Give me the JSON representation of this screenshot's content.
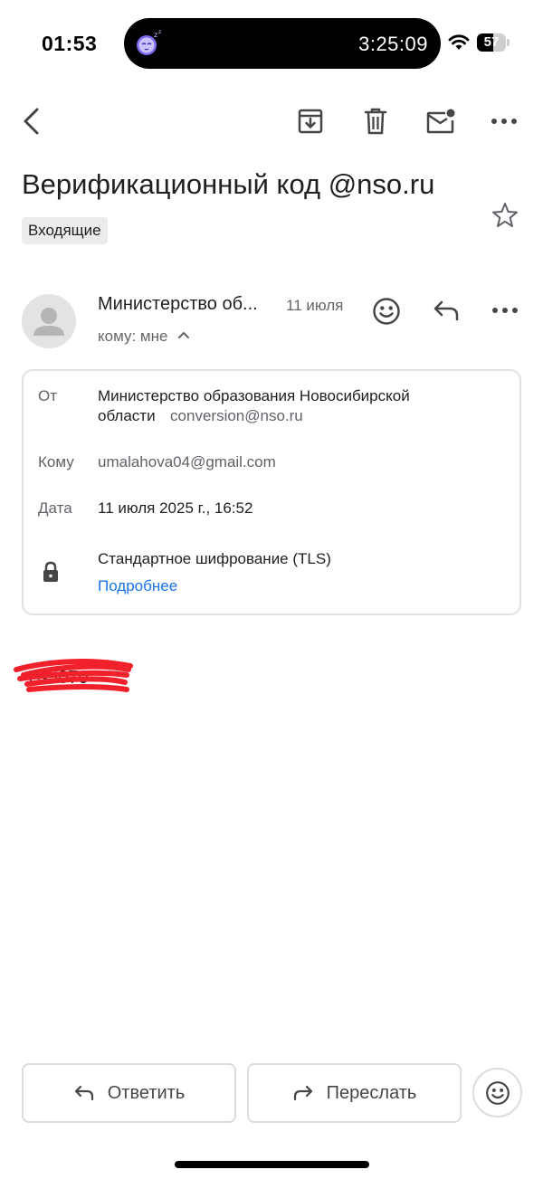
{
  "status_bar": {
    "time": "01:53",
    "island_time": "3:25:09",
    "battery_level": "57",
    "battery_fraction": 0.57
  },
  "toolbar": {
    "back_icon": "chevron-left-icon",
    "archive_icon": "archive-icon",
    "delete_icon": "trash-icon",
    "mark_unread_icon": "mark-unread-icon",
    "more_icon": "more-horizontal-icon"
  },
  "email": {
    "subject": "Верификационный код @nso.ru",
    "label": "Входящие",
    "starred": false,
    "sender_name_short": "Министерство об...",
    "date_short": "11 июля",
    "to_summary": "кому: мне",
    "body_text": "1••5070"
  },
  "details": {
    "from_label": "От",
    "from_name_line1": "Министерство образования Новосибирской",
    "from_name_line2": "области",
    "from_email": "conversion@nso.ru",
    "to_label": "Кому",
    "to_value": "umalahova04@gmail.com",
    "date_label": "Дата",
    "date_value": "11 июля 2025 г., 16:52",
    "encryption": "Стандартное шифрование (TLS)",
    "details_link": "Подробнее"
  },
  "actions": {
    "reply": "Ответить",
    "forward": "Переслать"
  },
  "colors": {
    "link": "#1a73e8",
    "muted": "#5f6368",
    "redaction": "#f0212b"
  }
}
